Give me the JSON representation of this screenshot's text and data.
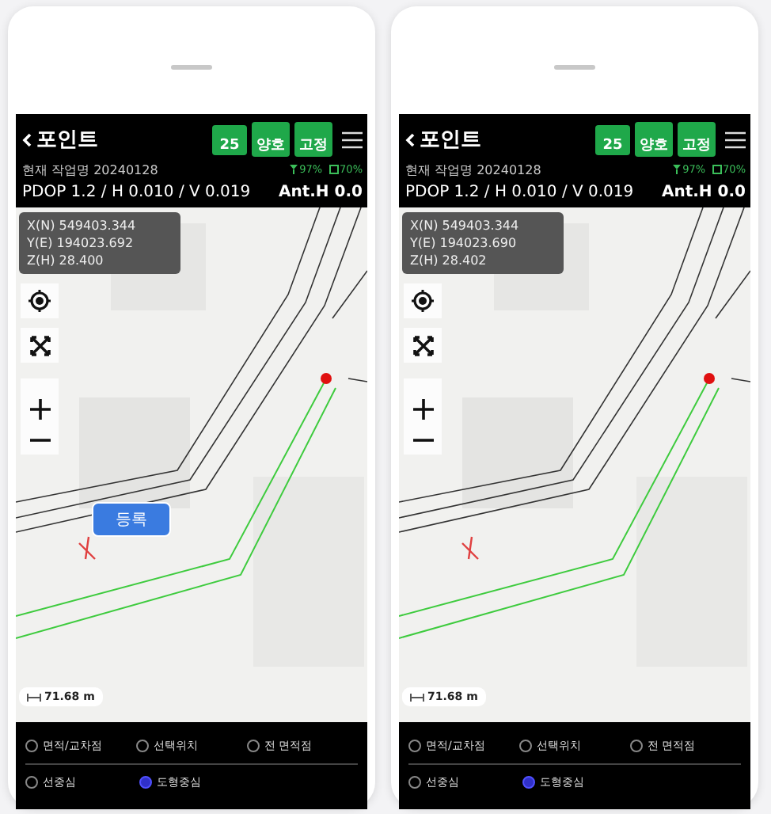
{
  "phones": [
    {
      "title": "포인트",
      "badges": [
        "25",
        "양호",
        "고정"
      ],
      "job": "현재 작업명 20240128",
      "signal": "97%",
      "battery": "70%",
      "accuracy": "PDOP 1.2 / H 0.010 / V 0.019",
      "antenna": "Ant.H 0.0",
      "coords": [
        "X(N) 549403.344",
        "Y(E) 194023.692",
        "Z(H) 28.400"
      ],
      "register_button": "등록",
      "scale": "71.68 m",
      "options": [
        {
          "label": "면적/교차점",
          "selected": false
        },
        {
          "label": "선택위치",
          "selected": false
        },
        {
          "label": "전 면적점",
          "selected": false
        },
        {
          "label": "선중심",
          "selected": false
        },
        {
          "label": "도형중심",
          "selected": true
        }
      ]
    },
    {
      "title": "포인트",
      "badges": [
        "25",
        "양호",
        "고정"
      ],
      "job": "현재 작업명 20240128",
      "signal": "97%",
      "battery": "70%",
      "accuracy": "PDOP 1.2 / H 0.010 / V 0.019",
      "antenna": "Ant.H 0.0",
      "coords": [
        "X(N) 549403.344",
        "Y(E) 194023.690",
        "Z(H) 28.402"
      ],
      "scale": "71.68 m",
      "options": [
        {
          "label": "면적/교차점",
          "selected": false
        },
        {
          "label": "선택위치",
          "selected": false
        },
        {
          "label": "전 면적점",
          "selected": false
        },
        {
          "label": "선중심",
          "selected": false
        },
        {
          "label": "도형중심",
          "selected": true
        }
      ]
    }
  ]
}
